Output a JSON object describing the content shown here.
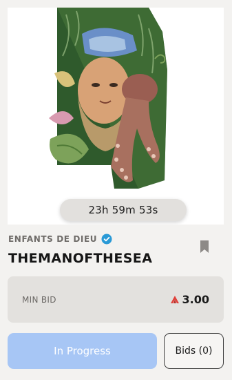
{
  "artwork": {
    "timer": "23h 59m 53s"
  },
  "collection": {
    "name": "ENFANTS DE DIEU"
  },
  "nft": {
    "title": "THEMANOFTHESEA"
  },
  "bid": {
    "label": "MIN BID",
    "value": "3.00"
  },
  "actions": {
    "progress_label": "In Progress",
    "bids_label": "Bids (0)"
  },
  "colors": {
    "accent": "#a7c6f5",
    "verified": "#2a9ad6",
    "currency": "#e0413b"
  },
  "icons": {
    "verified": "verified-badge-icon",
    "bookmark": "bookmark-icon",
    "currency": "currency-icon"
  }
}
